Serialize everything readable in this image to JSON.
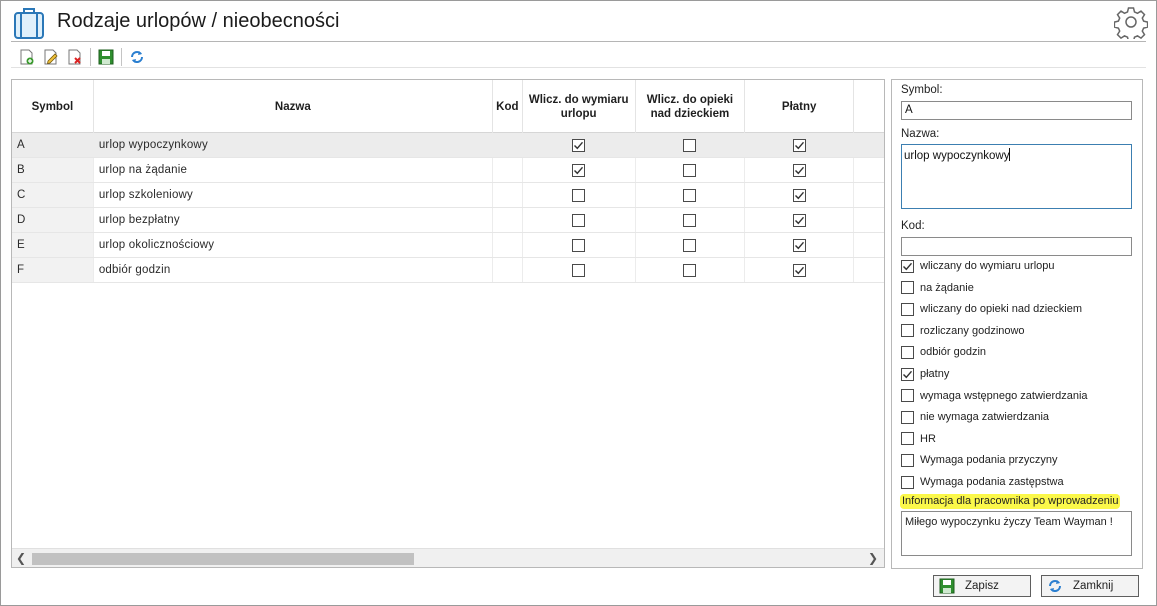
{
  "window": {
    "title": "Rodzaje urlopów / nieobecności"
  },
  "toolbar": {
    "buttons": [
      "add-record-icon",
      "edit-record-icon",
      "delete-record-icon",
      "save-icon",
      "refresh-icon"
    ]
  },
  "grid": {
    "columns": [
      "Symbol",
      "Nazwa",
      "Kod",
      "Wlicz. do wymiaru urlopu",
      "Wlicz. do opieki nad dzieckiem",
      "Płatny"
    ],
    "rows": [
      {
        "symbol": "A",
        "nazwa": "urlop wypoczynkowy",
        "kod": "",
        "wymiar": true,
        "opieka": false,
        "platny": true
      },
      {
        "symbol": "B",
        "nazwa": "urlop na żądanie",
        "kod": "",
        "wymiar": true,
        "opieka": false,
        "platny": true
      },
      {
        "symbol": "C",
        "nazwa": "urlop szkoleniowy",
        "kod": "",
        "wymiar": false,
        "opieka": false,
        "platny": true
      },
      {
        "symbol": "D",
        "nazwa": "urlop bezpłatny",
        "kod": "",
        "wymiar": false,
        "opieka": false,
        "platny": true
      },
      {
        "symbol": "E",
        "nazwa": "urlop okolicznościowy",
        "kod": "",
        "wymiar": false,
        "opieka": false,
        "platny": true
      },
      {
        "symbol": "F",
        "nazwa": "odbiór godzin",
        "kod": "",
        "wymiar": false,
        "opieka": false,
        "platny": true
      }
    ],
    "selected_row": 0
  },
  "detail": {
    "symbol_label": "Symbol:",
    "symbol_value": "A",
    "nazwa_label": "Nazwa:",
    "nazwa_value": "urlop wypoczynkowy",
    "kod_label": "Kod:",
    "kod_value": "",
    "checkboxes": [
      {
        "label": "wliczany do wymiaru urlopu",
        "checked": true
      },
      {
        "label": "na żądanie",
        "checked": false
      },
      {
        "label": "wliczany do opieki nad dzieckiem",
        "checked": false
      },
      {
        "label": "rozliczany godzinowo",
        "checked": false
      },
      {
        "label": "odbiór godzin",
        "checked": false
      },
      {
        "label": "płatny",
        "checked": true
      },
      {
        "label": "wymaga wstępnego zatwierdzania",
        "checked": false
      },
      {
        "label": "nie wymaga zatwierdzania",
        "checked": false
      },
      {
        "label": "HR",
        "checked": false
      },
      {
        "label": "Wymaga podania przyczyny",
        "checked": false
      },
      {
        "label": "Wymaga podania zastępstwa",
        "checked": false
      }
    ],
    "info_label": "Informacja dla pracownika po wprowadzeniu",
    "info_value": "Miłego wypoczynku życzy Team Wayman !",
    "highlight_color": "#fbf84a"
  },
  "footer": {
    "save_label": "Zapisz",
    "close_label": "Zamknij"
  }
}
